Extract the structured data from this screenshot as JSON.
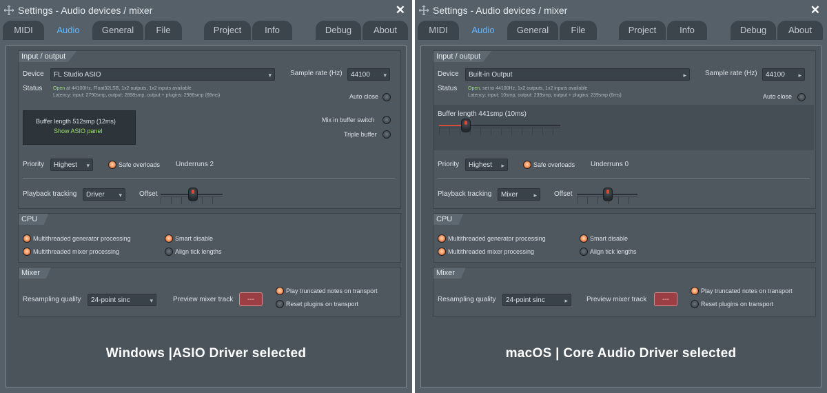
{
  "left": {
    "title": "Settings - Audio devices / mixer",
    "close": "✕",
    "tabs": [
      "MIDI",
      "Audio",
      "General",
      "File",
      "Project",
      "Info",
      "Debug",
      "About"
    ],
    "io_header": "Input / output",
    "device_label": "Device",
    "device_value": "FL Studio ASIO",
    "sample_rate_label": "Sample rate (Hz)",
    "sample_rate_value": "44100",
    "status_label": "Status",
    "status_open": "Open",
    "status_text": " at 44100Hz, Float32LSB, 1x2 outputs, 1x2 inputs available",
    "latency_text": "Latency: input: 2790smp, output: 2898smp, output + plugins: 2986smp (68ms)",
    "auto_close": "Auto close",
    "buffer_length": "Buffer length 512smp (12ms)",
    "show_asio": "Show ASIO panel",
    "mix_in_buffer": "Mix in buffer switch",
    "triple_buffer": "Triple buffer",
    "priority_label": "Priority",
    "priority_value": "Highest",
    "safe_overloads": "Safe overloads",
    "underruns": "Underruns 2",
    "playback_tracking_label": "Playback tracking",
    "playback_tracking_value": "Driver",
    "offset_label": "Offset",
    "cpu_header": "CPU",
    "mt_gen": "Multithreaded generator processing",
    "mt_mixer": "Multithreaded mixer processing",
    "smart_disable": "Smart disable",
    "align_tick": "Align tick lengths",
    "mixer_header": "Mixer",
    "resampling_label": "Resampling quality",
    "resampling_value": "24-point sinc",
    "preview_label": "Preview mixer track",
    "preview_value": "---",
    "play_truncated": "Play truncated notes on transport",
    "reset_plugins": "Reset plugins on transport",
    "caption": "Windows  |ASIO Driver selected"
  },
  "right": {
    "title": "Settings - Audio devices / mixer",
    "close": "✕",
    "tabs": [
      "MIDI",
      "Audio",
      "General",
      "File",
      "Project",
      "Info",
      "Debug",
      "About"
    ],
    "io_header": "Input / output",
    "device_label": "Device",
    "device_value": "Built-in Output",
    "sample_rate_label": "Sample rate (Hz)",
    "sample_rate_value": "44100",
    "status_label": "Status",
    "status_open": "Open",
    "status_text": ", set to 44100Hz, 1x2 outputs, 1x2 inputs available",
    "latency_text": "Latency: input: 10smp, output: 239smp, output + plugins: 239smp (6ms)",
    "auto_close": "Auto close",
    "buffer_length": "Buffer length 441smp (10ms)",
    "priority_label": "Priority",
    "priority_value": "Highest",
    "safe_overloads": "Safe overloads",
    "underruns": "Underruns 0",
    "playback_tracking_label": "Playback tracking",
    "playback_tracking_value": "Mixer",
    "offset_label": "Offset",
    "cpu_header": "CPU",
    "mt_gen": "Multithreaded generator processing",
    "mt_mixer": "Multithreaded mixer processing",
    "smart_disable": "Smart disable",
    "align_tick": "Align tick lengths",
    "mixer_header": "Mixer",
    "resampling_label": "Resampling quality",
    "resampling_value": "24-point sinc",
    "preview_label": "Preview mixer track",
    "preview_value": "---",
    "play_truncated": "Play truncated notes on transport",
    "reset_plugins": "Reset plugins on transport",
    "caption": "macOS  |  Core Audio Driver selected"
  },
  "icons": {
    "title_icon": "settings-move-icon",
    "dropdown_arrow": "▾",
    "submenu_arrow": "▸"
  },
  "colors": {
    "active_tab_text": "#62b7ff",
    "status_open": "#9ee26a",
    "preview_button": "#9c3f44"
  }
}
